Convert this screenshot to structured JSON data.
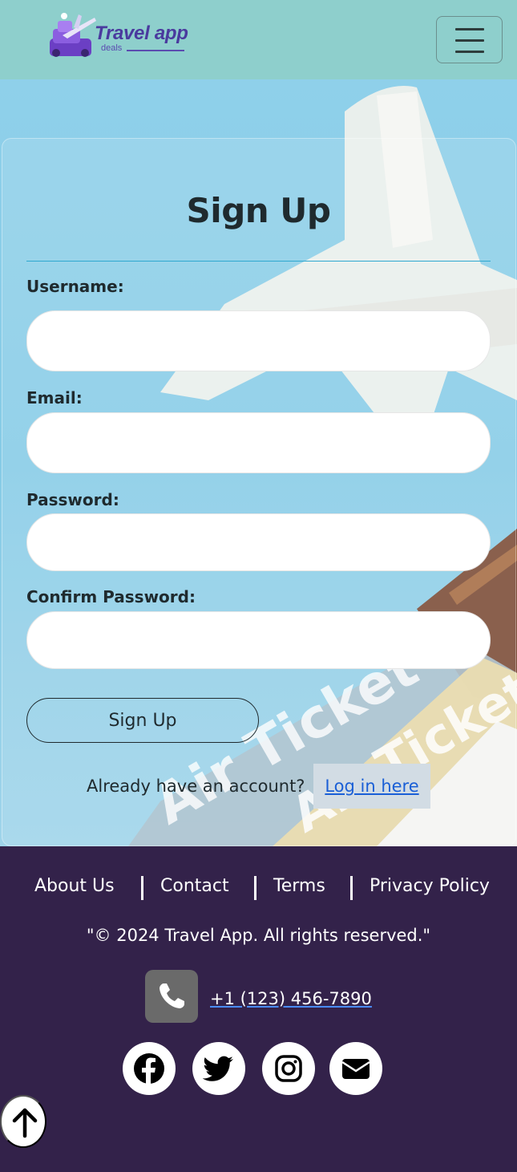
{
  "header": {
    "logo_title": "Travel app",
    "logo_subtitle": "deals",
    "menu_icon": "hamburger-menu-icon"
  },
  "form": {
    "title": "Sign Up",
    "username_label": "Username:",
    "email_label": "Email:",
    "password_label": "Password:",
    "confirm_password_label": "Confirm Password:",
    "username_value": "",
    "email_value": "",
    "password_value": "",
    "confirm_password_value": "",
    "submit_label": "Sign Up",
    "already_text": "Already have an account?",
    "login_link": "Log in here"
  },
  "footer": {
    "links": [
      "About Us",
      "Contact",
      "Terms",
      "Privacy Policy"
    ],
    "copyright": "\"© 2024 Travel App. All rights reserved.\"",
    "phone": " +1 (123) 456-7890",
    "social_icons": [
      "facebook-icon",
      "twitter-icon",
      "instagram-icon",
      "email-icon"
    ]
  },
  "colors": {
    "header_bg": "#8ecfcc",
    "footer_bg": "#33224a",
    "link_blue": "#1a5fd6",
    "divider": "#2fa8d0"
  }
}
